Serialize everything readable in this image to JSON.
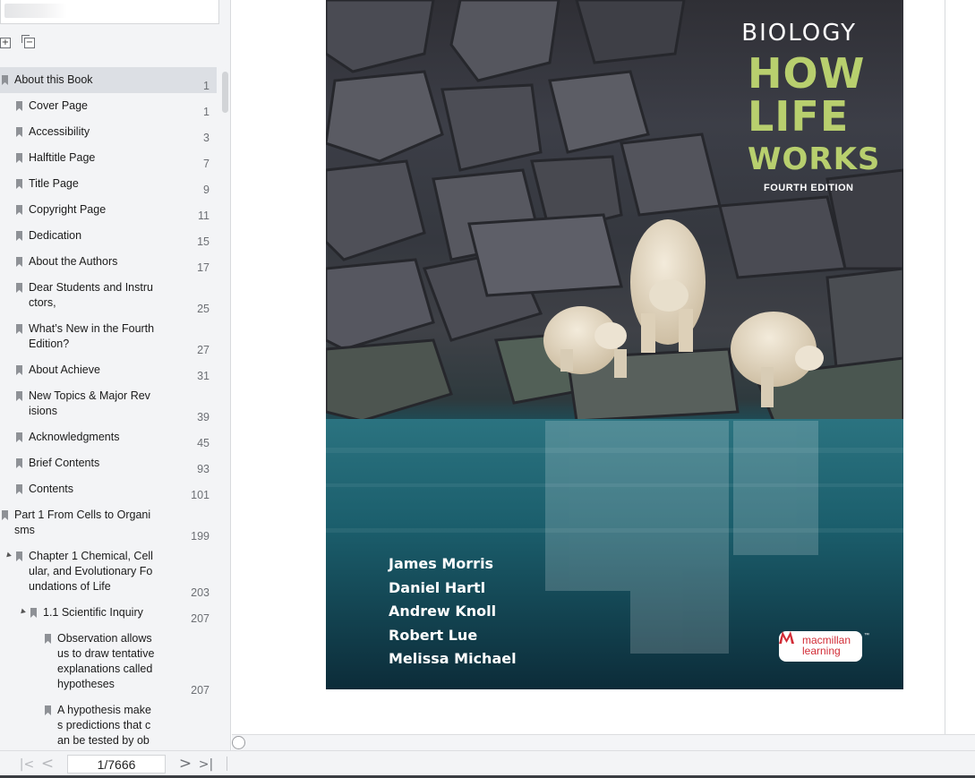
{
  "toc": [
    {
      "label": "About this Book",
      "page": "1",
      "level": 0,
      "active": true
    },
    {
      "label": "Cover Page",
      "page": "1",
      "level": 1
    },
    {
      "label": "Accessibility",
      "page": "3",
      "level": 1
    },
    {
      "label": "Halftitle Page",
      "page": "7",
      "level": 1
    },
    {
      "label": "Title Page",
      "page": "9",
      "level": 1
    },
    {
      "label": "Copyright Page",
      "page": "11",
      "level": 1
    },
    {
      "label": "Dedication",
      "page": "15",
      "level": 1
    },
    {
      "label": "About the Authors",
      "page": "17",
      "level": 1
    },
    {
      "label": "Dear Students and Instru\nctors,",
      "page": "25",
      "level": 1
    },
    {
      "label": "What’s New in the Fourth\nEdition?",
      "page": "27",
      "level": 1
    },
    {
      "label": "About Achieve",
      "page": "31",
      "level": 1
    },
    {
      "label": "New Topics & Major Rev\nisions",
      "page": "39",
      "level": 1
    },
    {
      "label": "Acknowledgments",
      "page": "45",
      "level": 1
    },
    {
      "label": "Brief Contents",
      "page": "93",
      "level": 1
    },
    {
      "label": "Contents",
      "page": "101",
      "level": 1
    },
    {
      "label": "Part 1 From Cells to Organi\nsms",
      "page": "199",
      "level": 0
    },
    {
      "label": "Chapter 1 Chemical, Cell\nular, and Evolutionary Fo\nundations of Life",
      "page": "203",
      "level": 1,
      "expanded": true
    },
    {
      "label": "1.1 Scientific Inquiry",
      "page": "207",
      "level": 2,
      "expanded": true
    },
    {
      "label": "Observation allows\nus to draw tentative\nexplanations called\nhypotheses",
      "page": "207",
      "level": 3
    },
    {
      "label": "A hypothesis make\ns predictions that c\nan be tested by ob",
      "page": "",
      "level": 3
    }
  ],
  "toolbar": {
    "expand_all_icon": "expand-all-icon",
    "collapse_all_icon": "collapse-all-icon",
    "page_indicator": "1/7666",
    "first_page_glyph": "|<",
    "prev_page_glyph": "<",
    "next_page_glyph": ">",
    "last_page_glyph": ">|"
  },
  "cover": {
    "subject": "BIOLOGY",
    "title_line1": "HOW",
    "title_line2": "LIFE",
    "title_line3": "WORKS",
    "edition": "FOURTH EDITION",
    "authors": [
      "James Morris",
      "Daniel Hartl",
      "Andrew Knoll",
      "Robert Lue",
      "Melissa Michael"
    ],
    "publisher": "macmillan\nlearning",
    "publisher_tm": "™"
  },
  "colors": {
    "title_green": "#b8cf6e",
    "publisher_red": "#d22d37",
    "sidebar_bg": "#f3f4f6",
    "active_row": "#dcdfe4"
  }
}
